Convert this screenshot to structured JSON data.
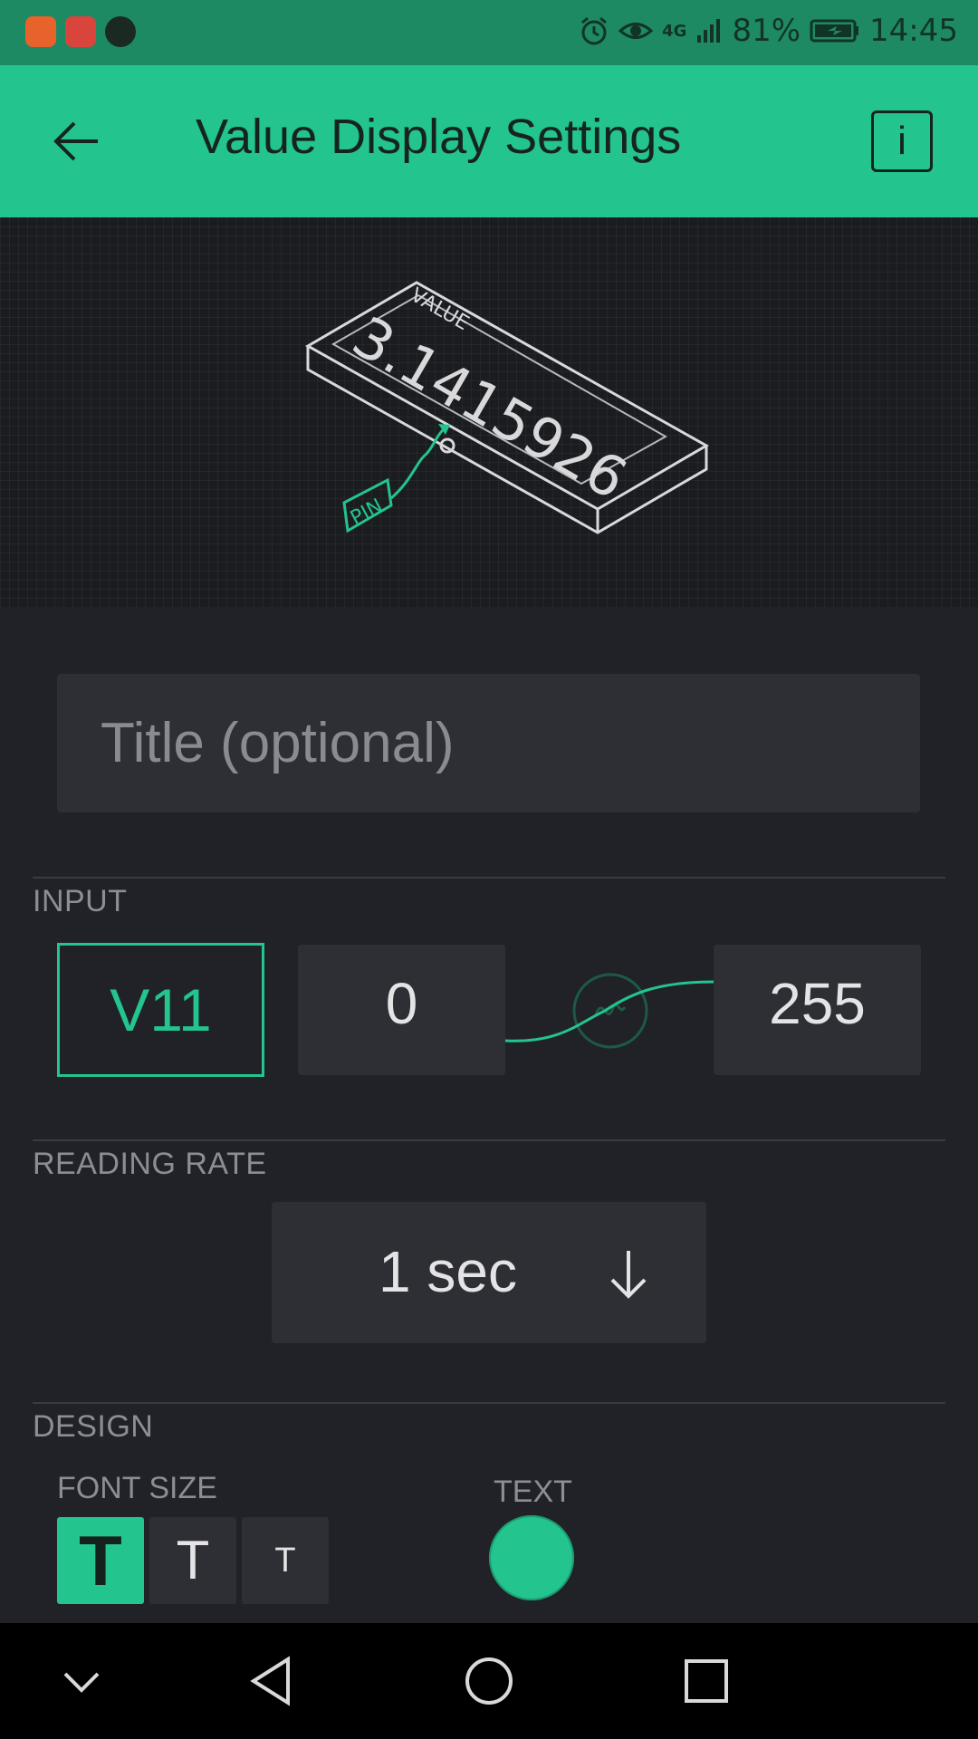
{
  "status_bar": {
    "battery": "81%",
    "time": "14:45",
    "network": "4G",
    "icons": [
      "taobao-app-icon",
      "huawei-store-icon",
      "audio-app-icon",
      "alarm-icon",
      "eye-icon",
      "signal-icon",
      "battery-icon"
    ]
  },
  "header": {
    "title": "Value Display Settings",
    "info_label": "i"
  },
  "preview": {
    "widget_label": "VALUE",
    "widget_value": "3.1415926",
    "pin_label": "PIN"
  },
  "title_field": {
    "placeholder": "Title (optional)",
    "value": ""
  },
  "input": {
    "section_label": "INPUT",
    "pin": "V11",
    "min": "0",
    "max": "255"
  },
  "reading_rate": {
    "section_label": "READING RATE",
    "value": "1 sec"
  },
  "design": {
    "section_label": "DESIGN",
    "font_size_label": "FONT SIZE",
    "text_label": "TEXT",
    "font_buttons": [
      "T",
      "T",
      "T"
    ],
    "selected_font_index": 0,
    "text_color": "#23c48e"
  },
  "colors": {
    "accent": "#23c48e",
    "background": "#212227",
    "field": "#2e2f34"
  }
}
